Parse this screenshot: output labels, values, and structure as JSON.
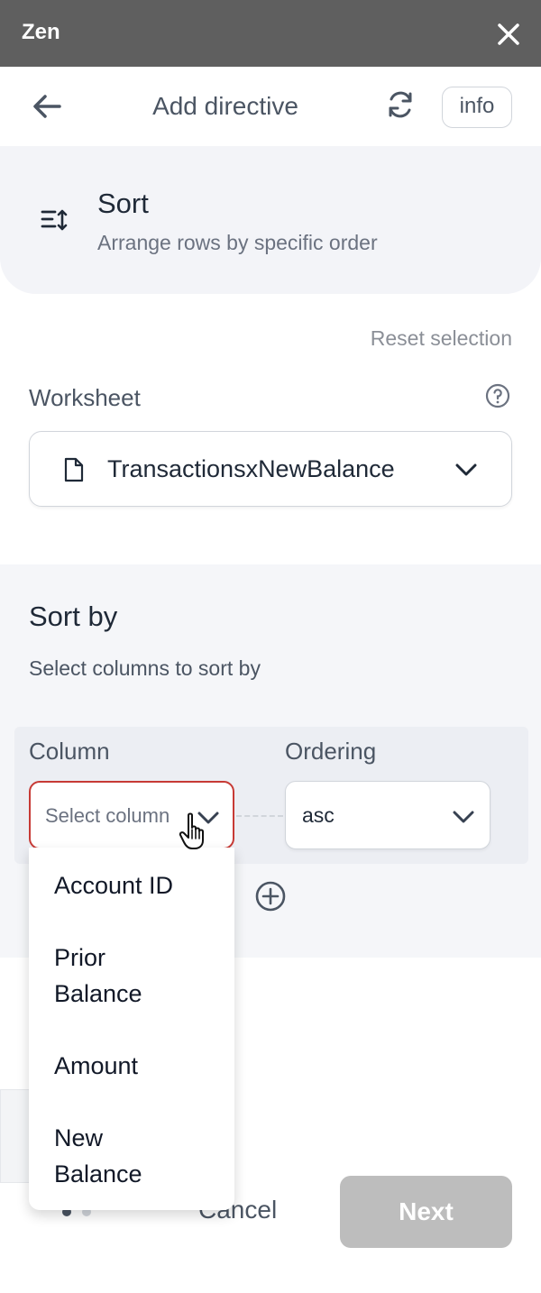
{
  "titlebar": {
    "app_title": "Zen"
  },
  "header": {
    "title": "Add directive",
    "info_label": "info"
  },
  "hero": {
    "title": "Sort",
    "subtitle": "Arrange rows by specific order"
  },
  "reset_label": "Reset selection",
  "worksheet": {
    "label": "Worksheet",
    "value": "TransactionsxNewBalance"
  },
  "sort_by": {
    "title": "Sort by",
    "subtitle": "Select columns to sort by",
    "column_label": "Column",
    "ordering_label": "Ordering",
    "column_placeholder": "Select column",
    "ordering_value": "asc"
  },
  "dropdown": {
    "options": [
      {
        "line1": "Account ID",
        "line2": ""
      },
      {
        "line1": "Prior",
        "line2": "Balance"
      },
      {
        "line1": "Amount",
        "line2": ""
      },
      {
        "line1": "New",
        "line2": "Balance"
      }
    ]
  },
  "footer": {
    "cancel_label": "Cancel",
    "next_label": "Next"
  },
  "colors": {
    "titlebar": "#5f5f5f",
    "active_border": "#c73a35",
    "next_disabled": "#bdbdbd",
    "panel_bg": "#f3f4f8"
  },
  "icons": [
    "close-icon",
    "back-arrow-icon",
    "refresh-icon",
    "sort-icon",
    "help-icon",
    "file-icon",
    "chevron-down-icon",
    "add-circle-icon",
    "hand-cursor-icon"
  ]
}
